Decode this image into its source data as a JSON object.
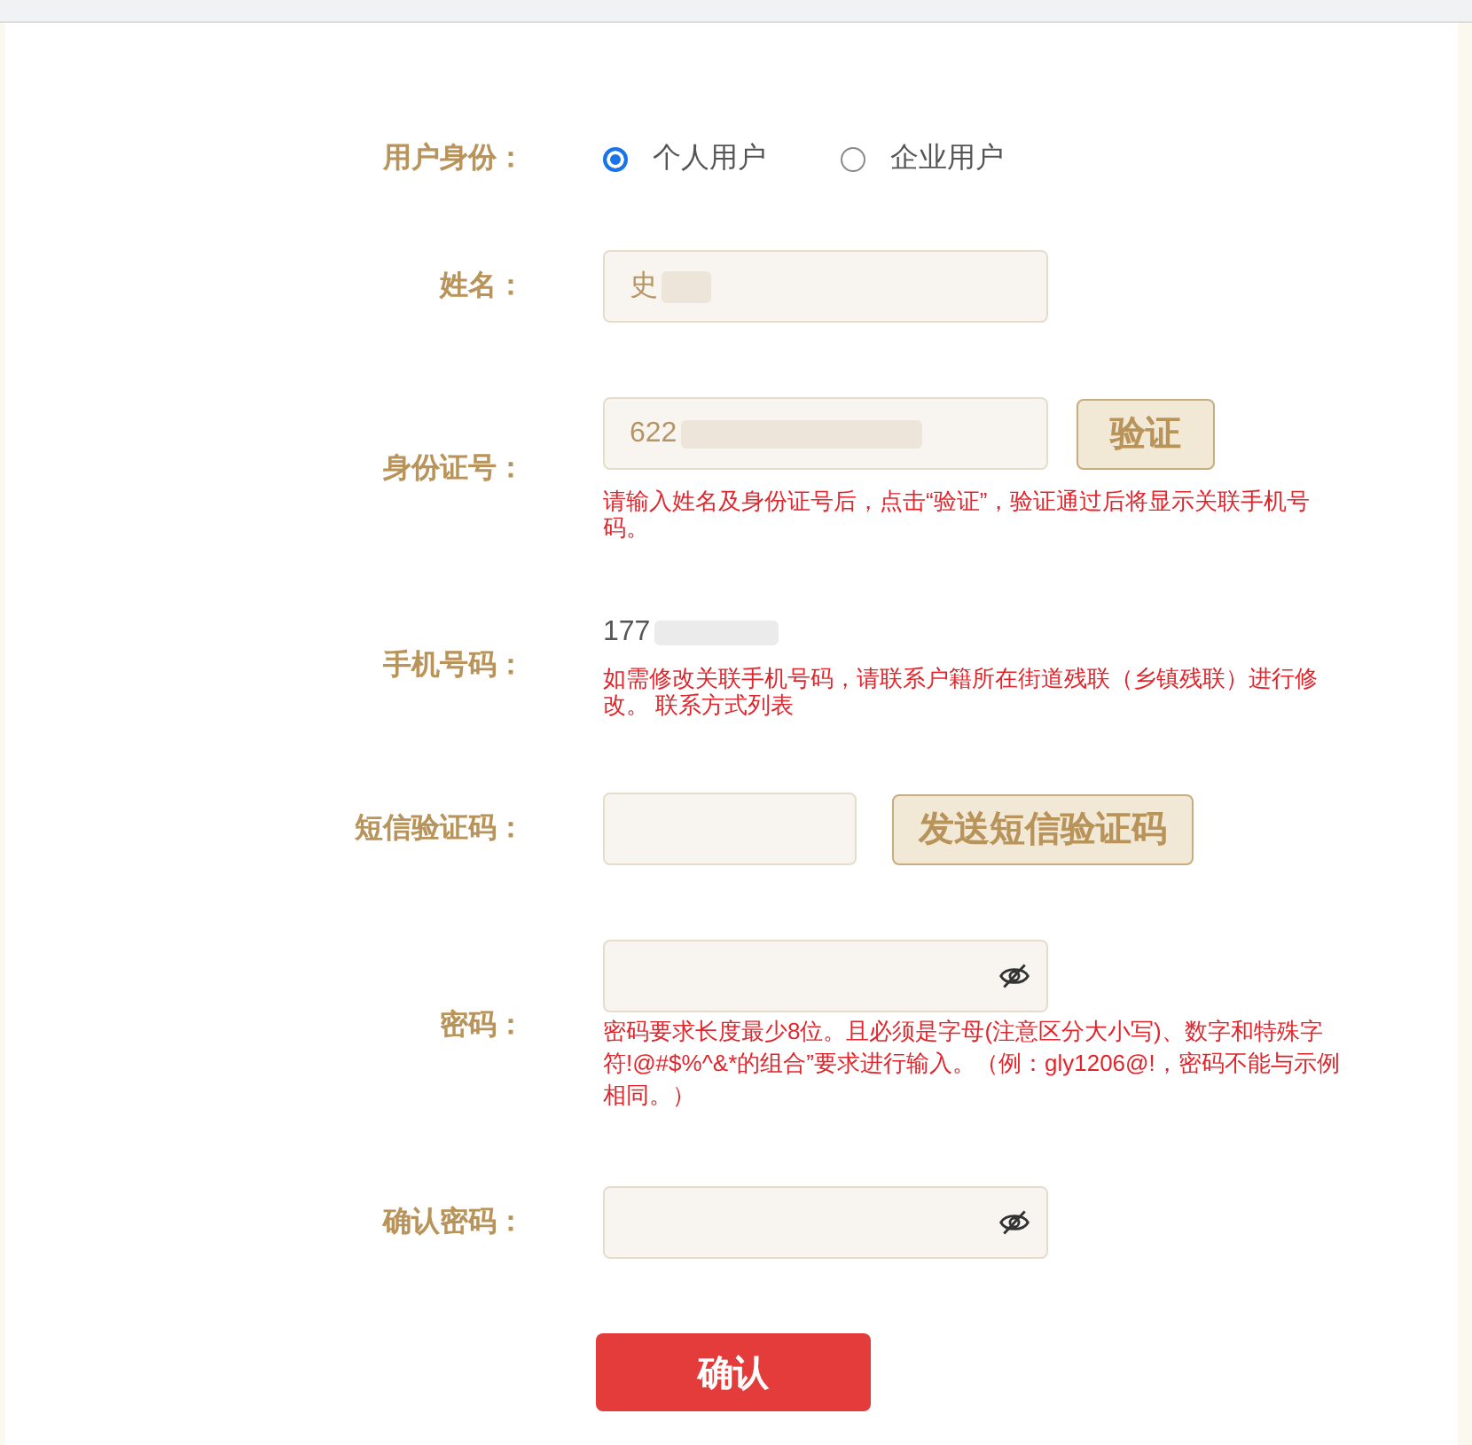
{
  "user_type": {
    "label": "用户身份：",
    "options": [
      {
        "label": "个人用户",
        "selected": true
      },
      {
        "label": "企业用户",
        "selected": false
      }
    ]
  },
  "fields": [
    {
      "kind": "text",
      "label": "姓名：",
      "value": "史",
      "redacted": true
    },
    {
      "kind": "text_with_button",
      "label": "身份证号：",
      "value": "622",
      "redacted": true,
      "button": "验证",
      "hint": "请输入姓名及身份证号后，点击“验证”，验证通过后将显示关联手机号码。"
    },
    {
      "kind": "readonly",
      "label": "手机号码：",
      "value": "177",
      "redacted": true,
      "hint": "如需修改关联手机号码，请联系户籍所在街道残联（乡镇残联）进行修改。",
      "hint_link": "联系方式列表"
    },
    {
      "kind": "code_with_button",
      "label": "短信验证码：",
      "button": "发送短信验证码"
    },
    {
      "kind": "password",
      "label": "密码：",
      "hint": "密码要求长度最少8位。且必须是字母(注意区分大小写)、数字和特殊字符!@#$%^&*的组合”要求进行输入。（例：gly1206@!，密码不能与示例相同。）"
    },
    {
      "kind": "password",
      "label": "确认密码："
    }
  ],
  "submit": "确认"
}
